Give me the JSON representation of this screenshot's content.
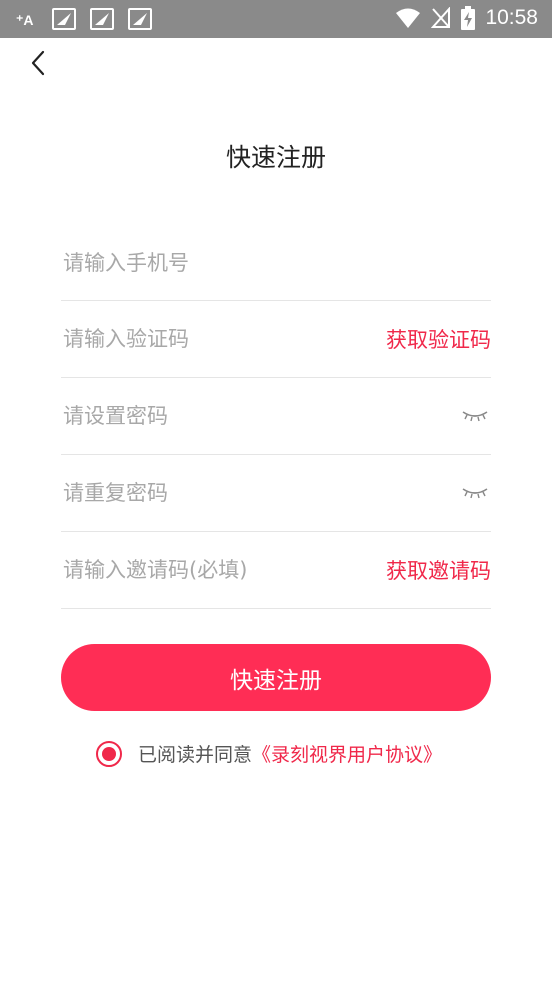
{
  "status_bar": {
    "time": "10:58",
    "notification_icons": [
      "keyboard-icon",
      "notification-icon",
      "notification-icon",
      "notification-icon"
    ]
  },
  "header": {
    "title": "快速注册"
  },
  "form": {
    "phone_placeholder": "请输入手机号",
    "code_placeholder": "请输入验证码",
    "get_code_label": "获取验证码",
    "password_placeholder": "请设置密码",
    "repeat_password_placeholder": "请重复密码",
    "invite_placeholder": "请输入邀请码(必填)",
    "get_invite_label": "获取邀请码"
  },
  "submit_label": "快速注册",
  "agreement": {
    "checked": true,
    "prefix": "已阅读并同意",
    "link": "《录刻视界用户协议》"
  },
  "colors": {
    "accent": "#ff2d55",
    "link": "#f0284a",
    "status_bar": "#8a8a8a"
  }
}
